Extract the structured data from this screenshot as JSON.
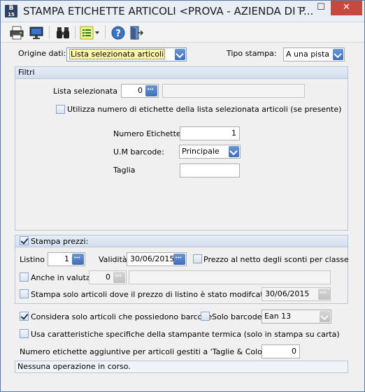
{
  "window": {
    "title": "STAMPA ETICHETTE ARTICOLI <PROVA - AZIENDA DI P...",
    "app_icon_text": "B",
    "app_icon_sub": "15",
    "minimize": "—",
    "maximize": "☐",
    "close": "✕"
  },
  "toolbar": {
    "icons": [
      "printer-icon",
      "monitor-icon",
      "binoculars-icon",
      "list-settings-icon",
      "help-icon",
      "exit-door-icon"
    ]
  },
  "origin": {
    "label": "Origine dati:",
    "value": "Lista selezionata articoli"
  },
  "print_type": {
    "label": "Tipo stampa:",
    "value": "A una pista"
  },
  "filters": {
    "title": "Filtri",
    "selected_list_label": "Lista selezionata",
    "selected_list_value": "0",
    "selected_list_desc": "",
    "use_labels_checkbox": "Utilizza numero di etichette della lista selezionata articoli (se presente)",
    "label_count_label": "Numero Etichette",
    "label_count_value": "1",
    "um_barcode_label": "U.M barcode:",
    "um_barcode_value": "Principale",
    "size_label": "Taglia",
    "size_value": ""
  },
  "prices": {
    "title": "Stampa prezzi:",
    "listino_label": "Listino",
    "listino_value": "1",
    "validity_label": "Validità",
    "validity_value": "30/06/2015",
    "net_price_label": "Prezzo al netto degli sconti per classe",
    "currency_label": "Anche in valuta",
    "currency_value": "0",
    "currency_desc": "",
    "modified_label": "Stampa solo articoli dove il prezzo di listino è stato modifcato dal",
    "modified_date": "30/06/2015"
  },
  "options": {
    "only_barcode_items": "Considera solo articoli che possiedono barcode",
    "only_barcode": "Solo barcode:",
    "barcode_type": "Ean 13",
    "thermal_printer": "Usa caratteristiche specifiche della stampante termica (solo in stampa su carta)",
    "extra_labels_label": "Numero etichette aggiuntive per articoli gestiti a 'Taglie & Colori'",
    "extra_labels_value": "0"
  },
  "status": {
    "text": "Nessuna operazione in corso."
  },
  "colors": {
    "accent": "#3e6fb8",
    "close": "#c7483c",
    "highlight": "#fff7a8"
  }
}
